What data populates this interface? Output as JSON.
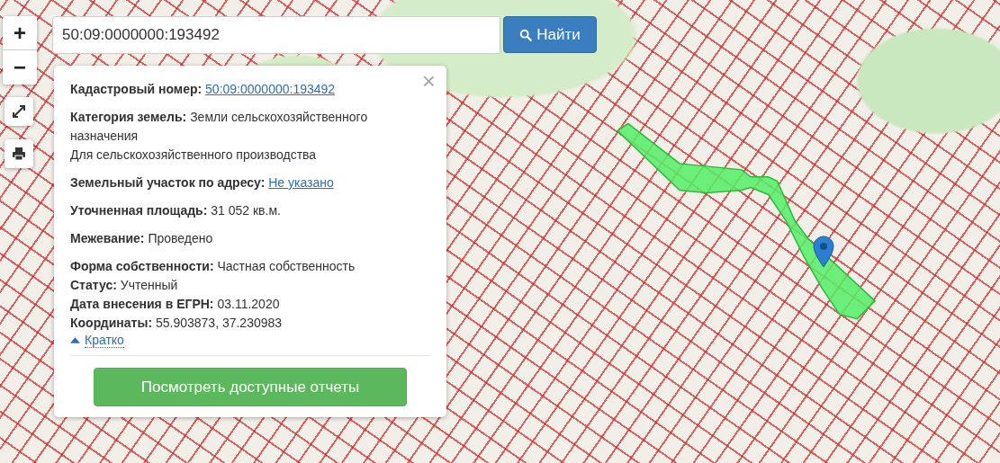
{
  "map_controls": {
    "zoom_in": "+",
    "zoom_out": "−"
  },
  "search": {
    "value": "50:09:0000000:193492",
    "button": "Найти"
  },
  "info_panel": {
    "close": "×",
    "groups": [
      {
        "lines": [
          {
            "label": "Кадастровый номер:",
            "value": "50:09:0000000:193492",
            "kind": "link"
          }
        ]
      },
      {
        "lines": [
          {
            "label": "Категория земель:",
            "value": "Земли сельскохозяйственного назначения",
            "kind": "text"
          },
          {
            "value": "Для сельскохозяйственного производства",
            "kind": "text"
          }
        ]
      },
      {
        "lines": [
          {
            "label": "Земельный участок по адресу:",
            "value": "Не указано",
            "kind": "link"
          }
        ]
      },
      {
        "lines": [
          {
            "label": "Уточненная площадь:",
            "value": "31 052 кв.м.",
            "kind": "text"
          }
        ]
      },
      {
        "lines": [
          {
            "label": "Межевание:",
            "value": "Проведено",
            "kind": "text"
          }
        ]
      },
      {
        "lines": [
          {
            "label": "Форма собственности:",
            "value": "Частная собственность",
            "kind": "text"
          },
          {
            "label": "Статус:",
            "value": "Учтенный",
            "kind": "text"
          },
          {
            "label": "Дата внесения в ЕГРН:",
            "value": "03.11.2020",
            "kind": "text"
          },
          {
            "label": "Координаты:",
            "value": "55.903873, 37.230983",
            "kind": "text"
          }
        ]
      }
    ],
    "toggle": {
      "label": "Кратко",
      "expanded": true
    },
    "reports_button": "Посмотреть доступные отчеты"
  }
}
